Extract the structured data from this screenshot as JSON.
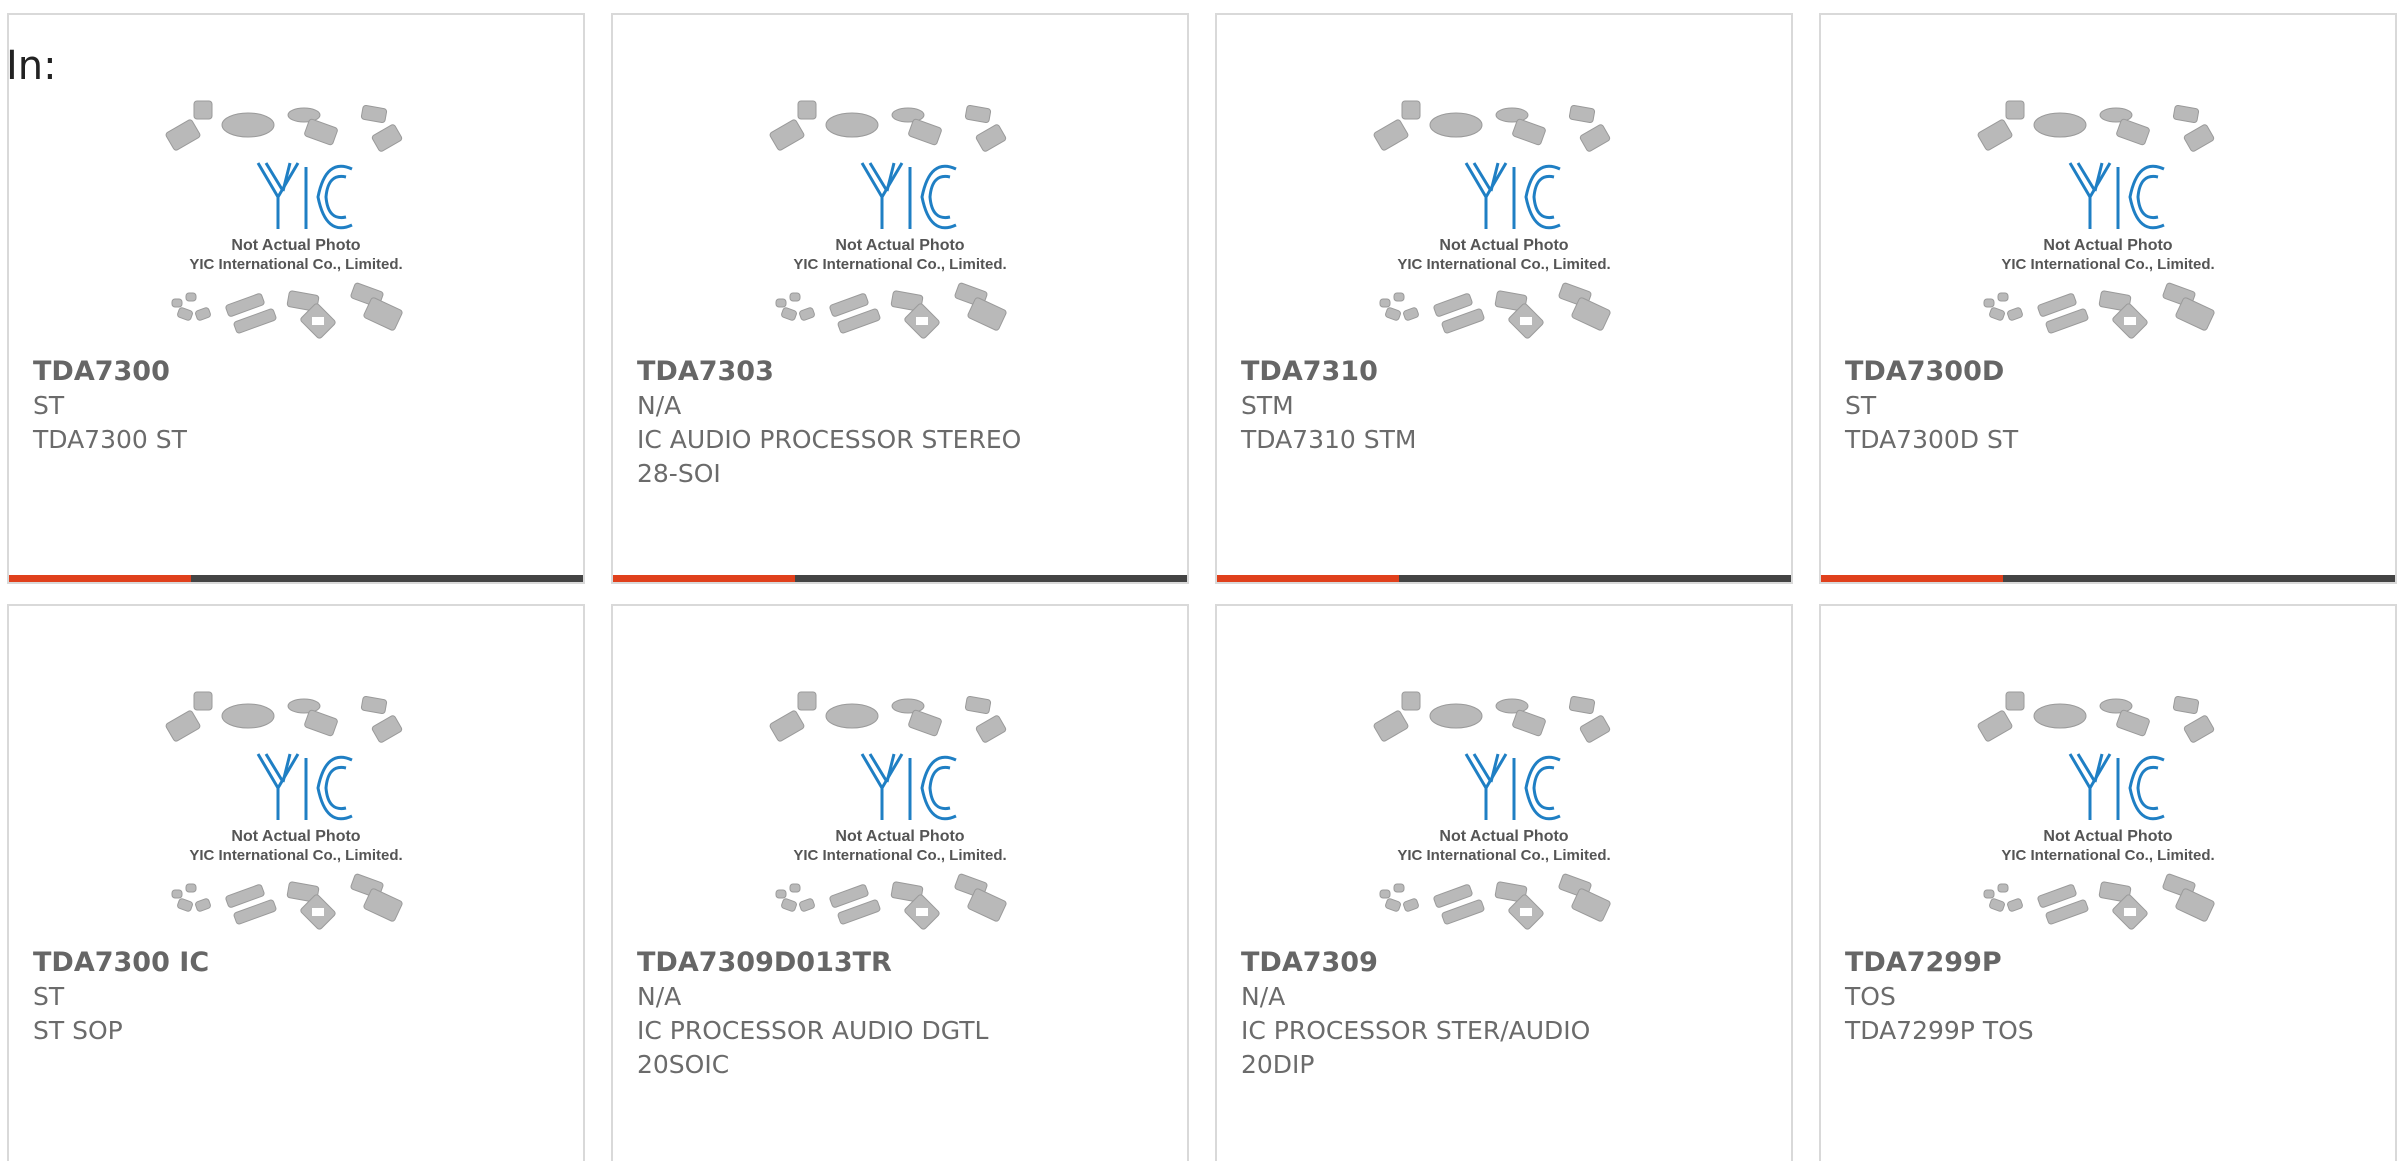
{
  "header": {
    "label": "In:"
  },
  "theme": {
    "accent": "#e0401c",
    "bar": "#444444",
    "logo_blue": "#1f7fc4"
  },
  "placeholder": {
    "line1": "Not Actual Photo",
    "line2": "YIC International Co., Limited.",
    "logo_text": "YIC"
  },
  "products": [
    {
      "part": "TDA7300",
      "maker": "ST",
      "desc": "TDA7300 ST",
      "bar": true
    },
    {
      "part": "TDA7303",
      "maker": "N/A",
      "desc": "IC AUDIO PROCESSOR STEREO 28-SOI",
      "bar": true
    },
    {
      "part": "TDA7310",
      "maker": "STM",
      "desc": "TDA7310 STM",
      "bar": true
    },
    {
      "part": "TDA7300D",
      "maker": "ST",
      "desc": "TDA7300D ST",
      "bar": true
    },
    {
      "part": "TDA7300 IC",
      "maker": "ST",
      "desc": "ST SOP",
      "bar": false
    },
    {
      "part": "TDA7309D013TR",
      "maker": "N/A",
      "desc": "IC PROCESSOR AUDIO DGTL 20SOIC",
      "bar": false
    },
    {
      "part": "TDA7309",
      "maker": "N/A",
      "desc": "IC PROCESSOR STER/AUDIO 20DIP",
      "bar": false
    },
    {
      "part": "TDA7299P",
      "maker": "TOS",
      "desc": "TDA7299P TOS",
      "bar": false
    }
  ]
}
